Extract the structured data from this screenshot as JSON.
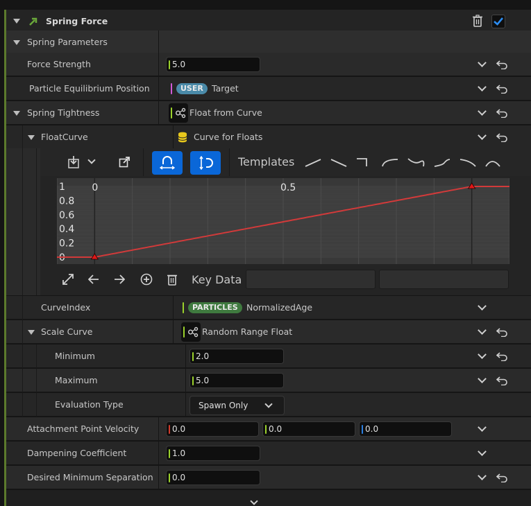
{
  "module": {
    "title": "Spring Force"
  },
  "section": {
    "label": "Spring Parameters"
  },
  "rows": {
    "force_strength": {
      "label": "Force Strength",
      "value": "5.0"
    },
    "equilibrium": {
      "label": "Particle Equilibrium Position",
      "badge": "USER",
      "value": "Target"
    },
    "tightness": {
      "label": "Spring Tightness",
      "value": "Float from Curve"
    },
    "floatcurve": {
      "label": "FloatCurve",
      "value": "Curve for Floats"
    },
    "curveindex": {
      "label": "CurveIndex",
      "badge": "PARTICLES",
      "value": "NormalizedAge"
    },
    "scalecurve": {
      "label": "Scale Curve",
      "value": "Random Range Float"
    },
    "minimum": {
      "label": "Minimum",
      "value": "2.0"
    },
    "maximum": {
      "label": "Maximum",
      "value": "5.0"
    },
    "evaltype": {
      "label": "Evaluation Type",
      "value": "Spawn Only"
    },
    "attach_vel": {
      "label": "Attachment Point Velocity",
      "x": "0.0",
      "y": "0.0",
      "z": "0.0"
    },
    "dampening": {
      "label": "Dampening Coefficient",
      "value": "1.0"
    },
    "min_sep": {
      "label": "Desired Minimum Separation Dis",
      "value": "0.0"
    }
  },
  "curve_editor": {
    "templates_label": "Templates",
    "key_data_label": "Key Data",
    "x_tick_labels": [
      "0",
      "0.5"
    ],
    "y_tick_labels": [
      "1",
      "0.8",
      "0.6",
      "0.4",
      "0.2",
      "0"
    ],
    "curve_color": "#d23a3a"
  },
  "colors": {
    "accent_green": "#9bd22b",
    "user_badge": "#4a8aa8",
    "particles_badge": "#3f7a3f",
    "toggle_blue": "#0a67d8"
  },
  "chart_data": {
    "type": "line",
    "x": [
      0,
      1
    ],
    "y": [
      0,
      1
    ],
    "xlim": [
      -0.1,
      1.1
    ],
    "ylim": [
      0,
      1
    ],
    "title": "",
    "xlabel": "",
    "ylabel": ""
  }
}
